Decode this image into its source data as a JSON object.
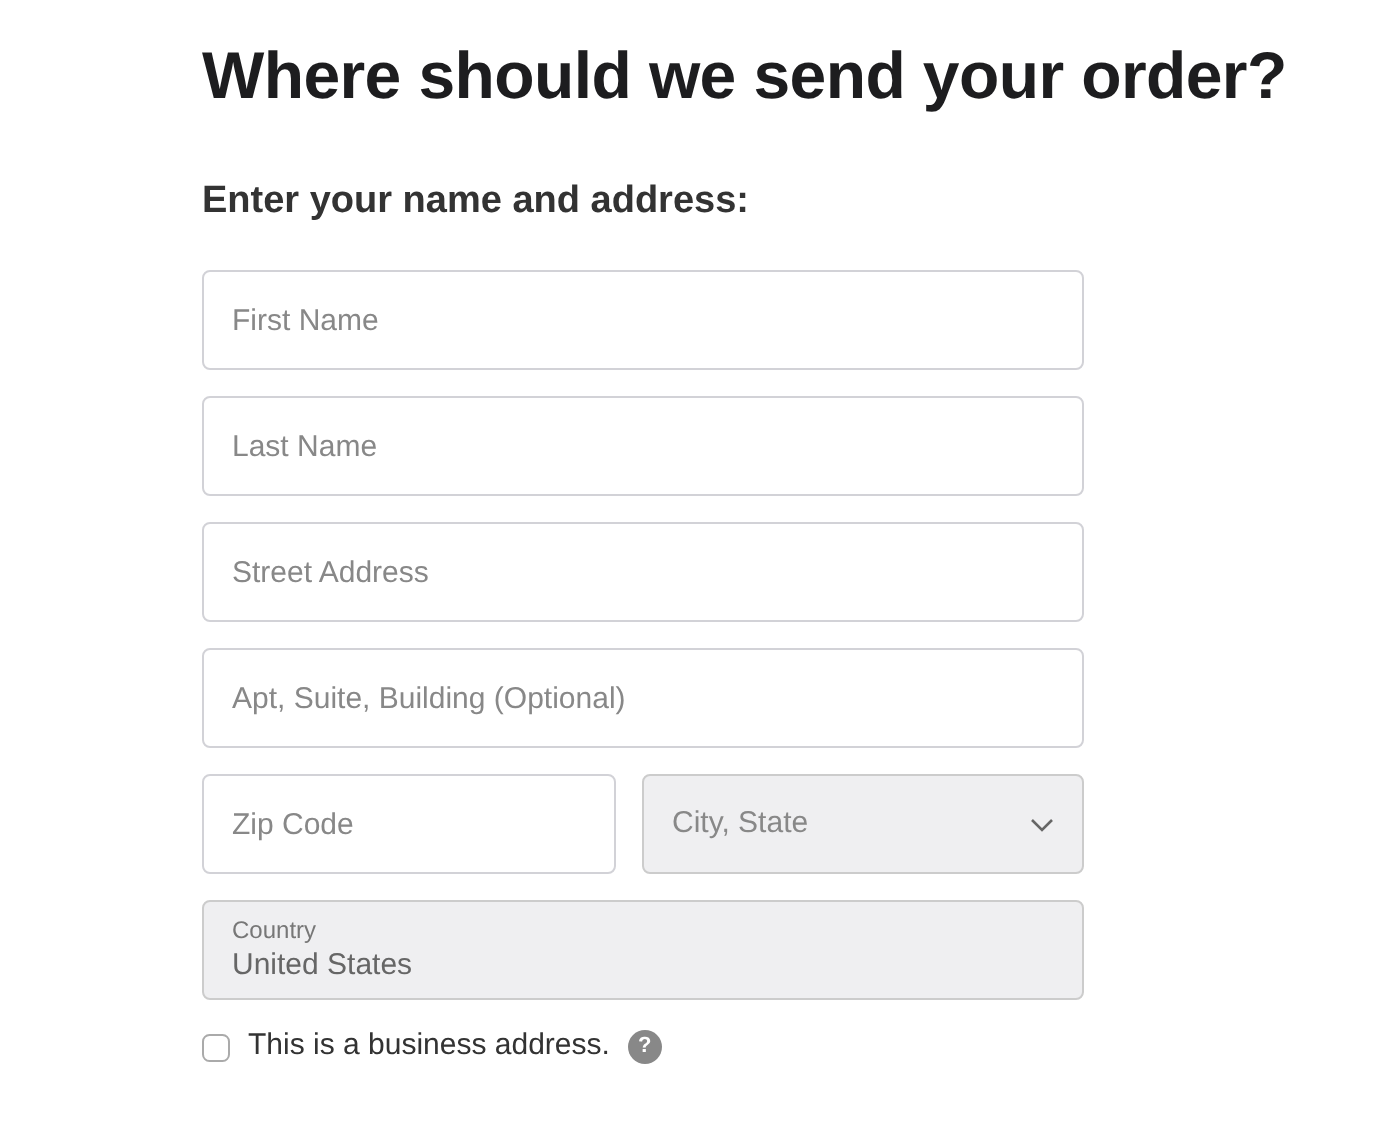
{
  "heading": "Where should we send your order?",
  "subheading": "Enter your name and address:",
  "rows": [
    [
      {
        "kind": "text",
        "placeholder": "First Name",
        "disabled": false
      }
    ],
    [
      {
        "kind": "text",
        "placeholder": "Last Name",
        "disabled": false
      }
    ],
    [
      {
        "kind": "text",
        "placeholder": "Street Address",
        "disabled": false
      }
    ],
    [
      {
        "kind": "text",
        "placeholder": "Apt, Suite, Building (Optional)",
        "disabled": false
      }
    ],
    [
      {
        "kind": "text",
        "placeholder": "Zip Code",
        "disabled": false
      },
      {
        "kind": "select",
        "placeholder": "City, State",
        "disabled": true
      }
    ],
    [
      {
        "kind": "floating",
        "label": "Country",
        "value": "United States",
        "disabled": true
      }
    ]
  ],
  "business": {
    "label": "This is a business address.",
    "checked": false,
    "help": "?"
  }
}
